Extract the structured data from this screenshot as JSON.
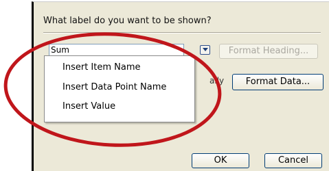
{
  "dialog": {
    "prompt": "What label do you want to be shown?",
    "field_value": "Sum",
    "format_heading_label": "Format Heading...",
    "format_data_label": "Format Data...",
    "obscured_text": "ally",
    "ok_label": "OK",
    "cancel_label": "Cancel"
  },
  "dropdown": {
    "items": [
      {
        "label": "Insert Item Name"
      },
      {
        "label": "Insert Data Point Name"
      },
      {
        "label": "Insert Value"
      }
    ]
  },
  "annotation": {
    "color": "#c0161b"
  }
}
